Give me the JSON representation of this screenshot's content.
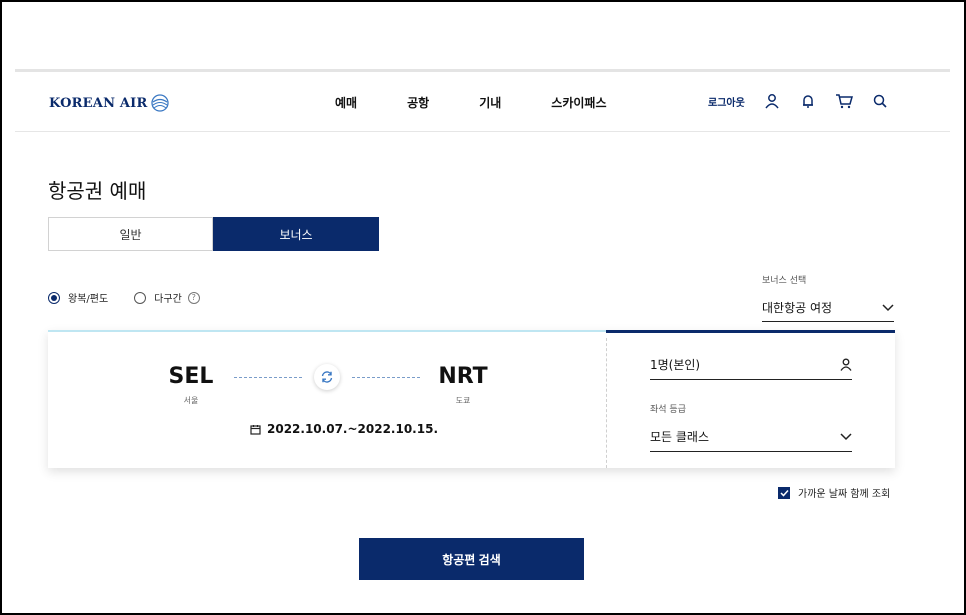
{
  "header": {
    "logo_text": "KOREAN AIR",
    "nav": [
      "예매",
      "공항",
      "기내",
      "스카이패스"
    ],
    "logout_label": "로그아웃"
  },
  "page": {
    "title": "항공권 예매",
    "tabs": [
      {
        "label": "일반",
        "active": false
      },
      {
        "label": "보너스",
        "active": true
      }
    ]
  },
  "trip_type": {
    "options": [
      {
        "label": "왕복/편도",
        "checked": true
      },
      {
        "label": "다구간",
        "checked": false
      }
    ],
    "help_glyph": "?"
  },
  "bonus": {
    "label": "보너스 선택",
    "selected": "대한항공 여정"
  },
  "route": {
    "origin_code": "SEL",
    "origin_city": "서울",
    "destination_code": "NRT",
    "destination_city": "도쿄",
    "dates": "2022.10.07.~2022.10.15."
  },
  "passengers": {
    "value": "1명(본인)"
  },
  "cabin": {
    "label": "좌석 등급",
    "selected": "모든 클래스"
  },
  "nearby_dates": {
    "label": "가까운 날짜 함께 조회",
    "checked": true
  },
  "search_button": {
    "label": "항공편 검색"
  },
  "colors": {
    "brand_navy": "#0a2a6b",
    "accent_light_blue": "#bfe6f2"
  }
}
